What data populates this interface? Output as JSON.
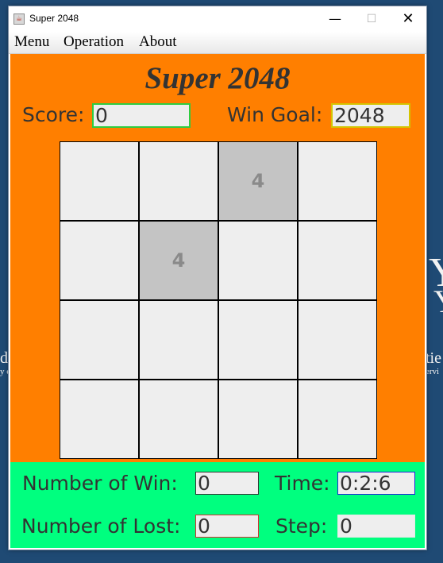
{
  "window": {
    "title": "Super 2048",
    "icon": "java-coffee-cup-icon"
  },
  "desktop": {
    "bg_color": "#1f4a74",
    "fragments": [
      "Y",
      "Y",
      "d",
      "y c",
      "tie",
      "ervi"
    ]
  },
  "menubar": {
    "items": [
      "Menu",
      "Operation",
      "About"
    ]
  },
  "game": {
    "title": "Super 2048",
    "score_label": "Score:",
    "score_value": "0",
    "goal_label": "Win Goal:",
    "goal_value": "2048",
    "panel_color": "#ff7f00"
  },
  "board": {
    "rows": [
      [
        "",
        "",
        "4",
        ""
      ],
      [
        "",
        "4",
        "",
        ""
      ],
      [
        "",
        "",
        "",
        ""
      ],
      [
        "",
        "",
        "",
        ""
      ]
    ]
  },
  "stats": {
    "panel_color": "#00ff7f",
    "win_label": "Number of Win:",
    "win_value": "0",
    "time_label": "Time:",
    "time_value": "0:2:6",
    "lost_label": "Number of Lost:",
    "lost_value": "0",
    "step_label": "Step:",
    "step_value": "0"
  }
}
